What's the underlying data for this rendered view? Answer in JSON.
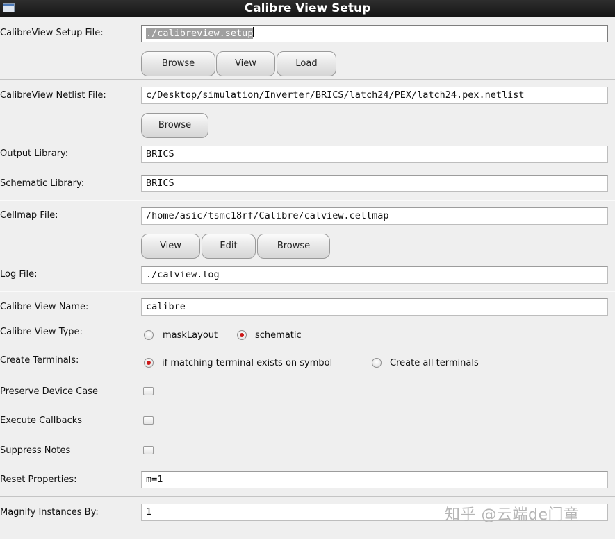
{
  "window": {
    "title": "Calibre View Setup"
  },
  "setup_file": {
    "label": "CalibreView Setup File:",
    "value": "./calibreview.setup"
  },
  "setup_buttons": {
    "browse": "Browse",
    "view": "View",
    "load": "Load"
  },
  "netlist_file": {
    "label": "CalibreView Netlist File:",
    "value": "c/Desktop/simulation/Inverter/BRICS/latch24/PEX/latch24.pex.netlist"
  },
  "netlist_buttons": {
    "browse": "Browse"
  },
  "output_library": {
    "label": "Output Library:",
    "value": "BRICS"
  },
  "schematic_library": {
    "label": "Schematic Library:",
    "value": "BRICS"
  },
  "cellmap_file": {
    "label": "Cellmap File:",
    "value": "/home/asic/tsmc18rf/Calibre/calview.cellmap"
  },
  "cellmap_buttons": {
    "view": "View",
    "edit": "Edit",
    "browse": "Browse"
  },
  "log_file": {
    "label": "Log File:",
    "value": "./calview.log"
  },
  "view_name": {
    "label": "Calibre View Name:",
    "value": "calibre"
  },
  "view_type": {
    "label": "Calibre View Type:",
    "options": [
      "maskLayout",
      "schematic"
    ],
    "selected": "schematic"
  },
  "create_terminals": {
    "label": "Create Terminals:",
    "options": [
      "if matching terminal exists on symbol",
      "Create all terminals"
    ],
    "selected": "if matching terminal exists on symbol"
  },
  "preserve_device_case": {
    "label": "Preserve Device Case",
    "checked": false
  },
  "execute_callbacks": {
    "label": "Execute Callbacks",
    "checked": false
  },
  "suppress_notes": {
    "label": "Suppress Notes",
    "checked": false
  },
  "reset_properties": {
    "label": "Reset Properties:",
    "value": "m=1"
  },
  "magnify_instances": {
    "label": "Magnify Instances By:",
    "value": "1"
  },
  "watermark": "知乎 @云端de门童"
}
